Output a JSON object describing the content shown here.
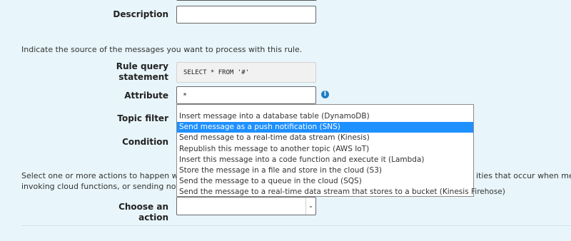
{
  "form": {
    "description_label": "Description",
    "source_instruction": "Indicate the source of the messages you want to process with this rule.",
    "rule_query_label_line1": "Rule query",
    "rule_query_label_line2": "statement",
    "rule_query_value": "SELECT * FROM '#'",
    "attribute_label": "Attribute",
    "attribute_value": "*",
    "topic_filter_label": "Topic filter",
    "condition_label": "Condition",
    "actions_instruction_line1_left": "Select one or more actions to happen when t",
    "actions_instruction_line1_right": "ities that occur when messag",
    "actions_instruction_line2": "invoking cloud functions, or sending notificati",
    "choose_action_label": "Choose an action",
    "choose_action_value": ""
  },
  "action_options": [
    "Insert message into a database table (DynamoDB)",
    "Send message as a push notification (SNS)",
    "Send message to a real-time data stream (Kinesis)",
    "Republish this message to another topic (AWS IoT)",
    "Insert this message into a code function and execute it (Lambda)",
    "Store the message in a file and store in the cloud (S3)",
    "Send the message to a queue in the cloud (SQS)",
    "Send the message to a real-time data stream that stores to a bucket (Kinesis Firehose)"
  ],
  "selected_option_index": 1,
  "colors": {
    "background": "#e8f5fa",
    "highlight": "#1e90ff",
    "info": "#1f7ec2"
  },
  "icons": {
    "info": "info-icon",
    "chevron": "chevron-down-icon"
  }
}
